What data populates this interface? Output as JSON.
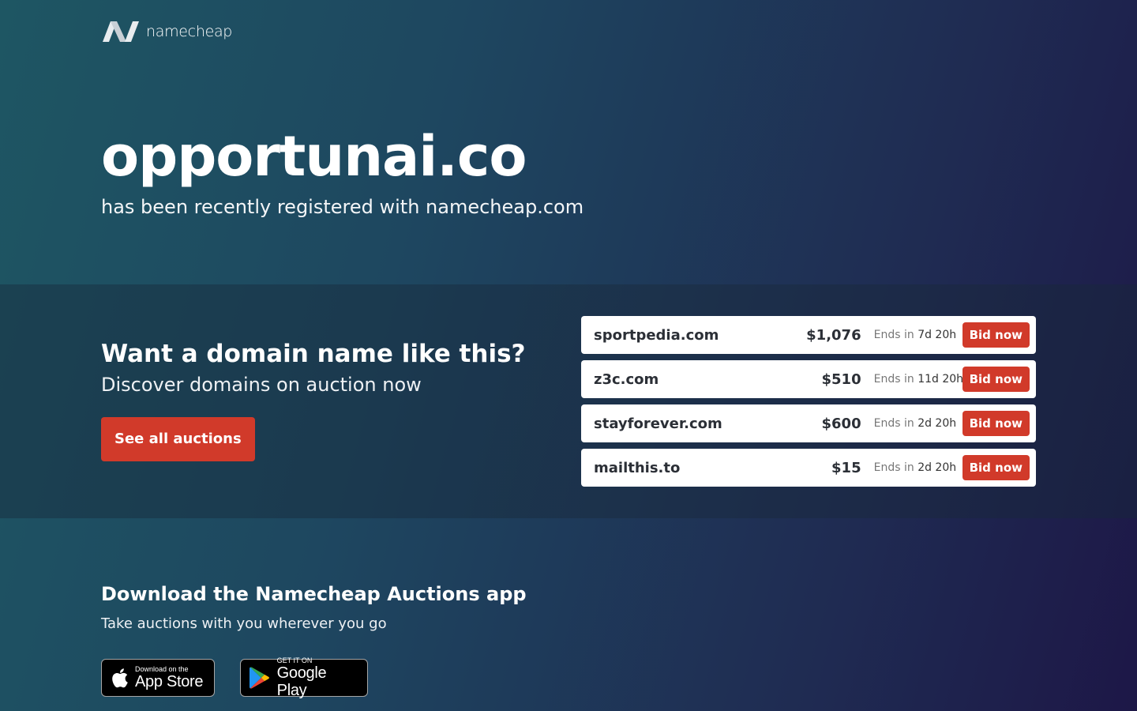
{
  "header": {
    "logo_text": "namecheap",
    "icon": "namecheap-logo-icon"
  },
  "hero": {
    "domain": "opportunai.co",
    "subtitle": "has been recently registered with namecheap.com"
  },
  "auctions": {
    "heading": "Want a domain name like this?",
    "subheading": "Discover domains on auction now",
    "cta_label": "See all auctions",
    "ends_label": "Ends in",
    "bid_label": "Bid now",
    "items": [
      {
        "name": "sportpedia.com",
        "price": "$1,076",
        "ends": "7d 20h"
      },
      {
        "name": "z3c.com",
        "price": "$510",
        "ends": "11d 20h"
      },
      {
        "name": "stayforever.com",
        "price": "$600",
        "ends": "2d 20h"
      },
      {
        "name": "mailthis.to",
        "price": "$15",
        "ends": "2d 20h"
      }
    ],
    "accent_color": "#d13a2a"
  },
  "app": {
    "heading": "Download the Namecheap Auctions app",
    "subheading": "Take auctions with you wherever you go",
    "app_store": {
      "small": "Download on the",
      "big": "App Store",
      "icon": "apple-icon"
    },
    "google_play": {
      "small": "GET IT ON",
      "big": "Google Play",
      "icon": "google-play-icon"
    }
  }
}
